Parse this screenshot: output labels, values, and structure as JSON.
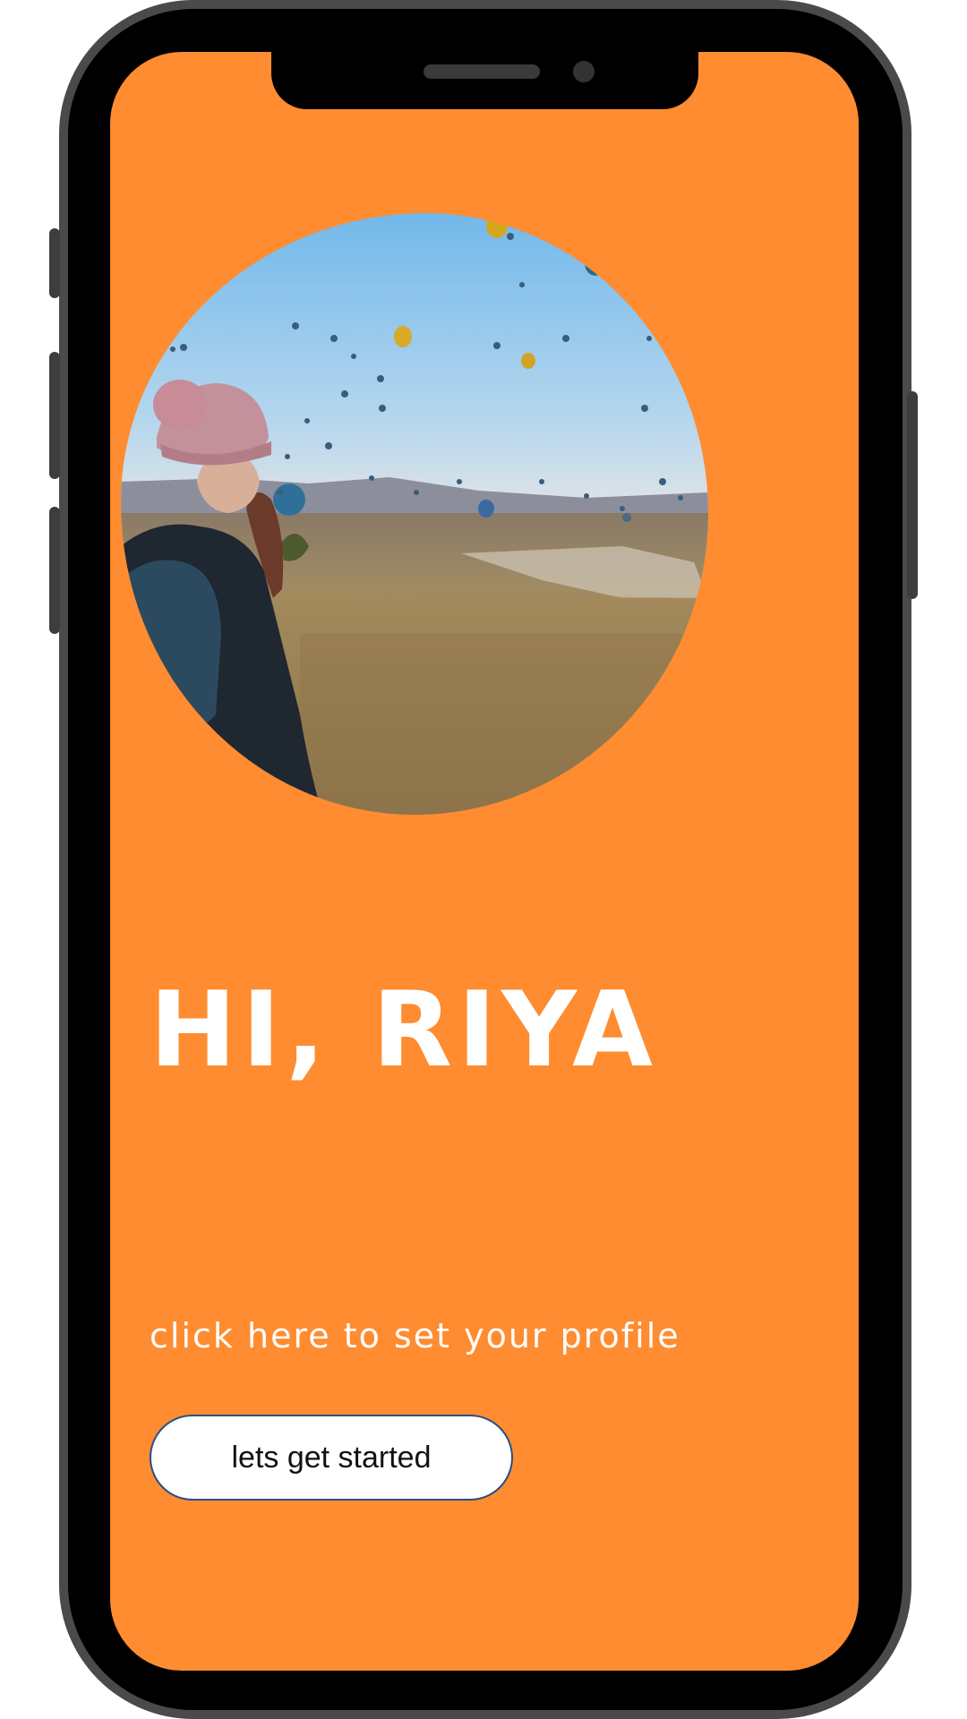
{
  "greeting": {
    "title": "HI, RIYA"
  },
  "profile_prompt": {
    "text": "click here to set your profile"
  },
  "cta_button": {
    "label": "lets get started"
  },
  "theme": {
    "screen_background": "#ff8c30",
    "text_color": "#ffffff",
    "button_background": "#ffffff",
    "button_border": "#2a4e86"
  },
  "hero_image": {
    "description_icon": "traveler-balloons-photo"
  }
}
